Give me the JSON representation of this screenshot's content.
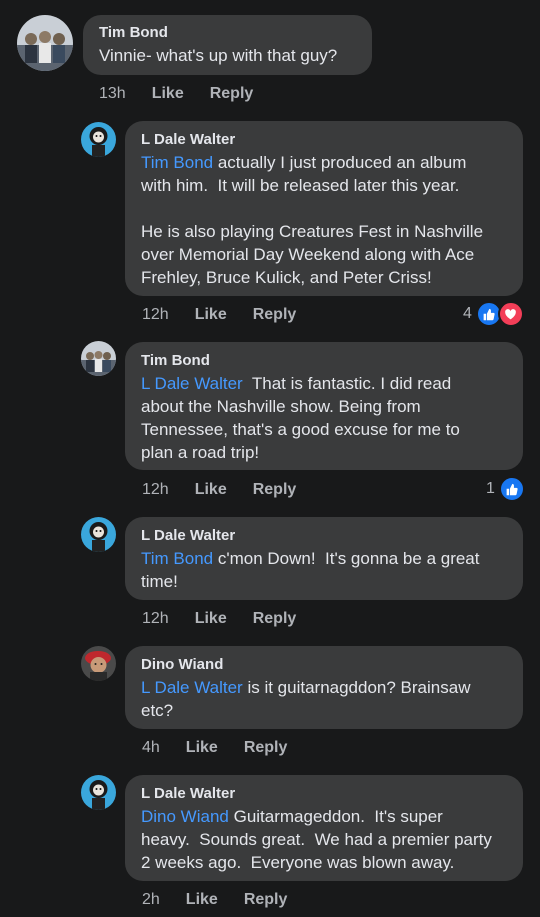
{
  "comments": [
    {
      "author": "Tim Bond",
      "mention": "",
      "text": "Vinnie- what's up with that guy?",
      "time": "13h",
      "like": "Like",
      "reply": "Reply",
      "reaction_count": ""
    },
    {
      "author": "L Dale Walter",
      "mention": "Tim Bond",
      "text": " actually I just produced an album\nwith him.  It will be released later this year.\n\nHe is also playing Creatures Fest in Nashville\nover Memorial Day Weekend along with Ace\nFrehley, Bruce Kulick, and Peter Criss!",
      "time": "12h",
      "like": "Like",
      "reply": "Reply",
      "reaction_count": "4"
    },
    {
      "author": "Tim Bond",
      "mention": "L Dale Walter",
      "text": "  That is fantastic. I did read\nabout the Nashville show. Being from\nTennessee, that's a good excuse for me to\nplan a road trip!",
      "time": "12h",
      "like": "Like",
      "reply": "Reply",
      "reaction_count": "1"
    },
    {
      "author": "L Dale Walter",
      "mention": "Tim Bond",
      "text": " c'mon Down!  It's gonna be a great\ntime!",
      "time": "12h",
      "like": "Like",
      "reply": "Reply",
      "reaction_count": ""
    },
    {
      "author": "Dino Wiand",
      "mention": "L Dale Walter",
      "text": " is it guitarnagddon? Brainsaw\netc?",
      "time": "4h",
      "like": "Like",
      "reply": "Reply",
      "reaction_count": ""
    },
    {
      "author": "L Dale Walter",
      "mention": "Dino Wiand",
      "text": " Guitarmageddon.  It's super\nheavy.  Sounds great.  We had a premier party\n2 weeks ago.  Everyone was blown away.",
      "time": "2h",
      "like": "Like",
      "reply": "Reply",
      "reaction_count": ""
    }
  ],
  "colors": {
    "background": "#18191a",
    "bubble": "#3a3b3c",
    "mention": "#4599ff",
    "meta": "#b0b3b8",
    "like_reaction": "#1877f2",
    "love_reaction": "#f33e58"
  }
}
